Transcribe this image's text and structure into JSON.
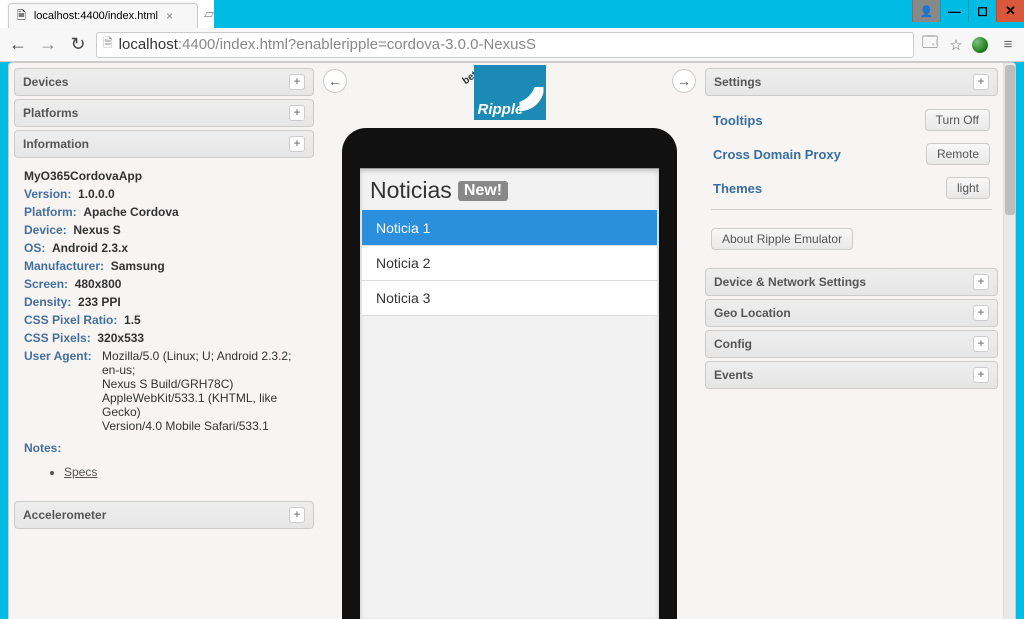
{
  "window": {
    "tab_title": "localhost:4400/index.html",
    "url_host": "localhost",
    "url_rest": ":4400/index.html?enableripple=cordova-3.0.0-NexusS"
  },
  "left": {
    "devices": "Devices",
    "platforms": "Platforms",
    "information": "Information",
    "accelerometer": "Accelerometer",
    "app_name": "MyO365CordovaApp",
    "rows": {
      "version_k": "Version:",
      "version_v": "1.0.0.0",
      "platform_k": "Platform:",
      "platform_v": "Apache Cordova",
      "device_k": "Device:",
      "device_v": "Nexus S",
      "os_k": "OS:",
      "os_v": "Android 2.3.x",
      "manufacturer_k": "Manufacturer:",
      "manufacturer_v": "Samsung",
      "screen_k": "Screen:",
      "screen_v": "480x800",
      "density_k": "Density:",
      "density_v": "233 PPI",
      "ratio_k": "CSS Pixel Ratio:",
      "ratio_v": "1.5",
      "pixels_k": "CSS Pixels:",
      "pixels_v": "320x533",
      "ua_k": "User Agent:",
      "ua_v1": "Mozilla/5.0 (Linux; U; Android 2.3.2; en-us;",
      "ua_v2": "Nexus S Build/GRH78C)",
      "ua_v3": "AppleWebKit/533.1 (KHTML, like Gecko)",
      "ua_v4": "Version/4.0 Mobile Safari/533.1"
    },
    "notes": "Notes:",
    "specs": "Specs"
  },
  "center": {
    "beta": "beta",
    "logo_text": "Ripple",
    "app_header": "Noticias",
    "badge": "New!",
    "items": {
      "i1": "Noticia 1",
      "i2": "Noticia 2",
      "i3": "Noticia 3"
    }
  },
  "right": {
    "settings": "Settings",
    "tooltips": "Tooltips",
    "tooltips_btn": "Turn Off",
    "proxy": "Cross Domain Proxy",
    "proxy_btn": "Remote",
    "themes": "Themes",
    "themes_btn": "light",
    "about": "About Ripple Emulator",
    "device_net": "Device & Network Settings",
    "geo": "Geo Location",
    "config": "Config",
    "events": "Events"
  }
}
